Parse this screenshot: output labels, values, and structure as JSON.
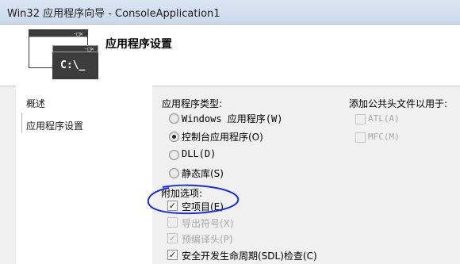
{
  "window": {
    "title": "Win32 应用程序向导 - ConsoleApplication1"
  },
  "header": {
    "title": "应用程序设置",
    "icon_text": "C:\\_"
  },
  "sidebar": {
    "items": [
      {
        "label": "概述"
      },
      {
        "label": "应用程序设置"
      }
    ]
  },
  "app_type": {
    "heading": "应用程序类型:",
    "options": [
      {
        "label": "Windows 应用程序(W)",
        "selected": false
      },
      {
        "label": "控制台应用程序(O)",
        "selected": true
      },
      {
        "label": "DLL(D)",
        "selected": false
      },
      {
        "label": "静态库(S)",
        "selected": false
      }
    ]
  },
  "extra_options": {
    "heading": "附加选项:",
    "items": [
      {
        "label": "空项目(E)",
        "checked": true,
        "enabled": true
      },
      {
        "label": "导出符号(X)",
        "checked": false,
        "enabled": false
      },
      {
        "label": "预编译头(P)",
        "checked": true,
        "enabled": false
      },
      {
        "label": "安全开发生命周期(SDL)检查(C)",
        "checked": true,
        "enabled": true
      }
    ]
  },
  "common_headers": {
    "heading": "添加公共头文件以用于:",
    "items": [
      {
        "label": "ATL(A)",
        "checked": false,
        "enabled": false
      },
      {
        "label": "MFC(M)",
        "checked": false,
        "enabled": false
      }
    ]
  },
  "colors": {
    "annotation": "#1c2fd0",
    "icon_dark": "#3c3c3c"
  }
}
